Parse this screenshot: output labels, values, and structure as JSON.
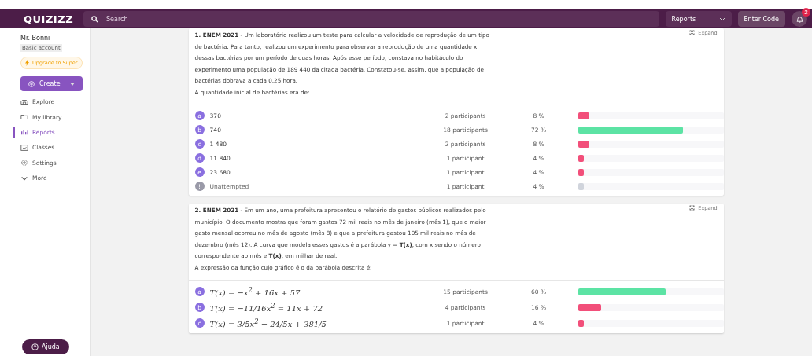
{
  "topbar": {
    "logo": "QUIZIZZ",
    "search": {
      "placeholder": "Search"
    },
    "view_select": "Reports",
    "enter_code": "Enter Code",
    "notifications": "2"
  },
  "sidebar": {
    "user": "Mr. Bonni",
    "account": "Basic account",
    "upgrade": "Upgrade to Super",
    "create": "Create",
    "items": [
      {
        "label": "Explore",
        "selected": false
      },
      {
        "label": "My library",
        "selected": false
      },
      {
        "label": "Reports",
        "selected": true
      },
      {
        "label": "Classes",
        "selected": false
      },
      {
        "label": "Settings",
        "selected": false
      },
      {
        "label": "More",
        "selected": false
      }
    ],
    "help": "Ajuda"
  },
  "questions": [
    {
      "kind": "text",
      "text": "**1. ENEM 2021** - Um laboratório realizou um teste para calcular a velocidade de reprodução de um tipo de bactéria. Para tanto, realizou um experimento para observar a reprodução de uma quantidade x dessas bactérias por um período de duas horas. Após esse período, constava no habitáculo do experimento uma população de 189 440 da citada bactéria. Constatou-se, assim, que a população de bactérias dobrava a cada 0,25 hora.",
      "prompt": "A quantidade inicial de bactérias era de:",
      "expand": "Expand",
      "answers": [
        {
          "letter": "a",
          "text": "370",
          "kind": "wrong",
          "participants": "2 participants",
          "percent": "8 %",
          "level": 0.08
        },
        {
          "letter": "b",
          "text": "740",
          "kind": "correct",
          "participants": "18 participants",
          "percent": "72 %",
          "level": 0.72
        },
        {
          "letter": "c",
          "text": "1 480",
          "kind": "wrong",
          "participants": "2 participants",
          "percent": "8 %",
          "level": 0.08
        },
        {
          "letter": "d",
          "text": "11 840",
          "kind": "wrong",
          "participants": "1 participant",
          "percent": "4 %",
          "level": 0.04
        },
        {
          "letter": "e",
          "text": "23 680",
          "kind": "wrong",
          "participants": "1 participant",
          "percent": "4 %",
          "level": 0.04
        },
        {
          "letter": "!",
          "text": "Unattempted",
          "kind": "unattempted",
          "participants": "1 participant",
          "percent": "4 %",
          "level": 0.04
        }
      ]
    },
    {
      "kind": "math",
      "text": "**2. ENEM 2021** - Em um ano, uma prefeitura apresentou o relatório de gastos públicos realizados pelo município. O documento mostra que foram gastos 72 mil reais no mês de janeiro (mês 1), que o maior gasto mensal ocorreu no mês de agosto (mês 8) e que a prefeitura gastou 105 mil reais no mês de dezembro (mês 12). A curva que modela esses gastos é a parábola y = **T(x)**, com x sendo o número correspondente ao mês e **T(x)**, em milhar de real.",
      "prompt": "A expressão da função cujo gráfico é o da parábola descrita é:",
      "expand": "Expand",
      "answers": [
        {
          "letter": "a",
          "text": "T(x) = −x$^{2}$ + 16x + 57",
          "kind": "correct",
          "participants": "15 participants",
          "percent": "60 %",
          "level": 0.6
        },
        {
          "letter": "b",
          "text": "T(x) = −11/16x$^{2}$ = 11x + 72",
          "kind": "wrong",
          "participants": "4 participants",
          "percent": "16 %",
          "level": 0.16
        },
        {
          "letter": "c",
          "text": "T(x) = 3/5x$^{2}$ − 24/5x + 381/5",
          "kind": "wrong",
          "participants": "1 participant",
          "percent": "4 %",
          "level": 0.04
        }
      ]
    }
  ]
}
